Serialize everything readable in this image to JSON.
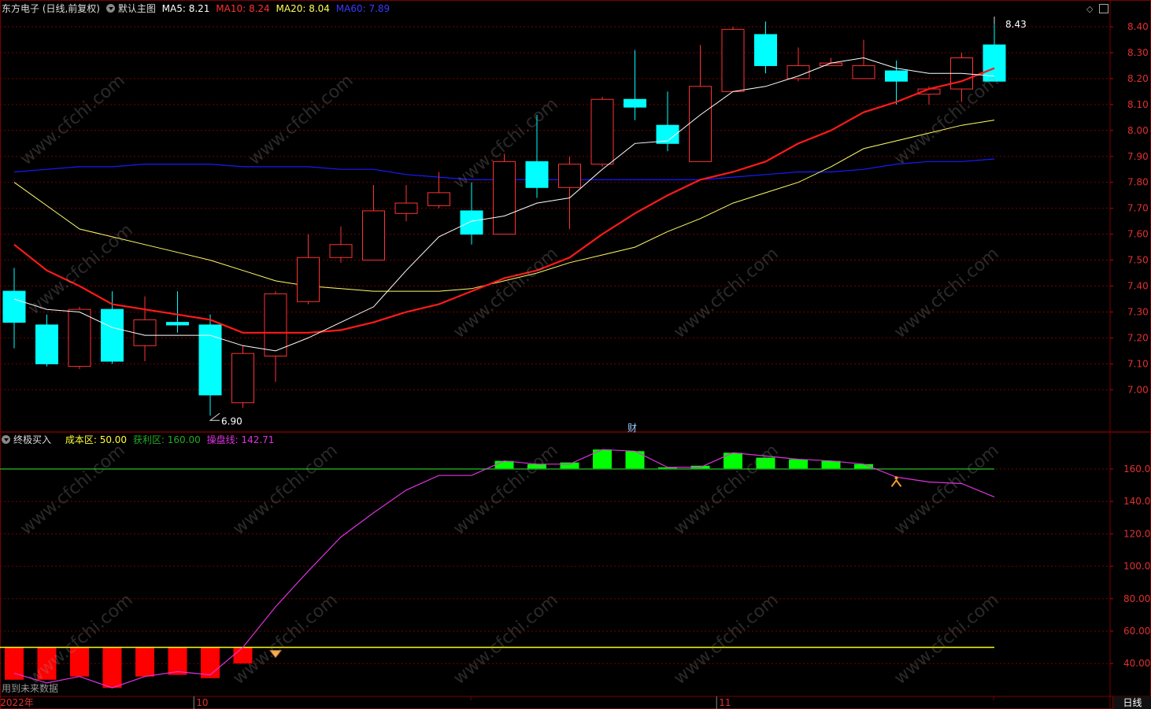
{
  "header_main": {
    "stock_title": "东方电子 (日线,前复权)",
    "template_name": "默认主图",
    "ma5": "MA5: 8.21",
    "ma10": "MA10: 8.24",
    "ma20": "MA20: 8.04",
    "ma60": "MA60: 7.89"
  },
  "header_sub": {
    "indicator_name": "终极买入",
    "cost_zone": "成本区: 50.00",
    "profit_zone": "获利区: 160.00",
    "control_line": "操盘线: 142.71"
  },
  "annotations": {
    "low_label": "6.90",
    "high_label": "8.43",
    "finance_marker": "财"
  },
  "bottom": {
    "status_text": "用到未来数据",
    "period_button": "日线"
  },
  "watermark_text": "www.cfchi.com",
  "colors": {
    "up": "#ff3232",
    "down": "#00ffff",
    "ma5": "#ffffff",
    "ma10": "#ff1a1a",
    "ma20": "#ffff66",
    "ma60": "#1a1aff",
    "grid": "#7a0000",
    "cost_line": "#ffff00",
    "profit_line": "#1fa01f",
    "control_line": "#dd33dd",
    "bar_green": "#00ff00",
    "bar_red": "#ff0000"
  },
  "chart_data": [
    {
      "type": "candlestick",
      "y_axis_labels": [
        "8.40",
        "8.30",
        "8.20",
        "8.10",
        "8.00",
        "7.90",
        "7.80",
        "7.70",
        "7.60",
        "7.50",
        "7.40",
        "7.30",
        "7.20",
        "7.10",
        "7.00"
      ],
      "ylim": [
        6.85,
        8.45
      ],
      "x_labels": [
        {
          "index": 0,
          "text": "2022年"
        },
        {
          "index": 6,
          "text": "10"
        },
        {
          "index": 22,
          "text": "11"
        }
      ],
      "candles": [
        {
          "o": 7.38,
          "h": 7.47,
          "l": 7.16,
          "c": 7.26
        },
        {
          "o": 7.25,
          "h": 7.29,
          "l": 7.09,
          "c": 7.1
        },
        {
          "o": 7.09,
          "h": 7.32,
          "l": 7.08,
          "c": 7.31
        },
        {
          "o": 7.31,
          "h": 7.38,
          "l": 7.1,
          "c": 7.11
        },
        {
          "o": 7.17,
          "h": 7.36,
          "l": 7.11,
          "c": 7.27
        },
        {
          "o": 7.26,
          "h": 7.38,
          "l": 7.22,
          "c": 7.25
        },
        {
          "o": 7.25,
          "h": 7.29,
          "l": 6.9,
          "c": 6.98
        },
        {
          "o": 6.95,
          "h": 7.17,
          "l": 6.93,
          "c": 7.14
        },
        {
          "o": 7.13,
          "h": 7.38,
          "l": 7.03,
          "c": 7.37
        },
        {
          "o": 7.34,
          "h": 7.6,
          "l": 7.33,
          "c": 7.51
        },
        {
          "o": 7.51,
          "h": 7.63,
          "l": 7.49,
          "c": 7.56
        },
        {
          "o": 7.5,
          "h": 7.79,
          "l": 7.5,
          "c": 7.69
        },
        {
          "o": 7.68,
          "h": 7.79,
          "l": 7.65,
          "c": 7.72
        },
        {
          "o": 7.71,
          "h": 7.84,
          "l": 7.7,
          "c": 7.76
        },
        {
          "o": 7.69,
          "h": 7.8,
          "l": 7.56,
          "c": 7.6
        },
        {
          "o": 7.6,
          "h": 7.91,
          "l": 7.6,
          "c": 7.88
        },
        {
          "o": 7.88,
          "h": 8.06,
          "l": 7.74,
          "c": 7.78
        },
        {
          "o": 7.78,
          "h": 7.9,
          "l": 7.62,
          "c": 7.87
        },
        {
          "o": 7.87,
          "h": 8.13,
          "l": 7.86,
          "c": 8.12
        },
        {
          "o": 8.12,
          "h": 8.31,
          "l": 8.04,
          "c": 8.09
        },
        {
          "o": 8.02,
          "h": 8.15,
          "l": 7.92,
          "c": 7.95
        },
        {
          "o": 7.88,
          "h": 8.33,
          "l": 7.88,
          "c": 8.17
        },
        {
          "o": 8.15,
          "h": 8.4,
          "l": 8.15,
          "c": 8.39
        },
        {
          "o": 8.37,
          "h": 8.42,
          "l": 8.22,
          "c": 8.25
        },
        {
          "o": 8.2,
          "h": 8.32,
          "l": 8.19,
          "c": 8.25
        },
        {
          "o": 8.25,
          "h": 8.28,
          "l": 8.25,
          "c": 8.26
        },
        {
          "o": 8.2,
          "h": 8.35,
          "l": 8.2,
          "c": 8.25
        },
        {
          "o": 8.23,
          "h": 8.27,
          "l": 8.1,
          "c": 8.19
        },
        {
          "o": 8.14,
          "h": 8.17,
          "l": 8.1,
          "c": 8.16
        },
        {
          "o": 8.16,
          "h": 8.3,
          "l": 8.11,
          "c": 8.28
        },
        {
          "o": 8.33,
          "h": 8.43,
          "l": 8.2,
          "c": 8.19
        }
      ],
      "ma5": [
        7.35,
        7.31,
        7.3,
        7.24,
        7.21,
        7.21,
        7.21,
        7.17,
        7.15,
        7.2,
        7.26,
        7.32,
        7.46,
        7.59,
        7.65,
        7.67,
        7.72,
        7.74,
        7.85,
        7.95,
        7.96,
        8.06,
        8.15,
        8.17,
        8.21,
        8.26,
        8.28,
        8.24,
        8.22,
        8.22,
        8.21
      ],
      "ma10": [
        7.56,
        7.46,
        7.4,
        7.33,
        7.31,
        7.29,
        7.27,
        7.22,
        7.22,
        7.22,
        7.23,
        7.26,
        7.3,
        7.33,
        7.38,
        7.43,
        7.46,
        7.51,
        7.6,
        7.68,
        7.75,
        7.81,
        7.84,
        7.88,
        7.95,
        8.0,
        8.07,
        8.11,
        8.16,
        8.19,
        8.24
      ],
      "ma20": [
        7.8,
        7.71,
        7.62,
        7.59,
        7.56,
        7.53,
        7.5,
        7.46,
        7.42,
        7.4,
        7.39,
        7.38,
        7.38,
        7.38,
        7.39,
        7.42,
        7.45,
        7.49,
        7.52,
        7.55,
        7.61,
        7.66,
        7.72,
        7.76,
        7.8,
        7.86,
        7.93,
        7.96,
        7.99,
        8.02,
        8.04
      ],
      "ma60": [
        7.84,
        7.85,
        7.86,
        7.86,
        7.87,
        7.87,
        7.87,
        7.86,
        7.86,
        7.86,
        7.85,
        7.85,
        7.83,
        7.82,
        7.81,
        7.81,
        7.81,
        7.81,
        7.81,
        7.81,
        7.81,
        7.81,
        7.82,
        7.83,
        7.84,
        7.84,
        7.85,
        7.87,
        7.88,
        7.88,
        7.89
      ]
    },
    {
      "type": "indicator",
      "y_axis_labels": [
        "160.0",
        "140.00",
        "120.00",
        "100.00",
        "80.00",
        "60.00",
        "40.00"
      ],
      "ylim": [
        24,
        180
      ],
      "cost_zone": 50,
      "profit_zone": 160,
      "control_line": [
        34,
        28,
        32,
        25,
        32,
        35,
        33,
        50,
        75,
        97,
        118,
        133,
        147,
        156,
        156,
        165,
        163,
        163,
        172,
        171,
        161,
        161,
        170,
        168,
        166,
        165,
        163,
        155,
        152,
        151,
        142.71
      ],
      "bar_top": [
        30,
        30,
        32,
        25,
        32,
        33,
        31,
        40,
        0,
        0,
        0,
        0,
        0,
        0,
        0,
        165,
        163,
        164,
        172,
        171,
        161,
        162,
        170,
        167,
        166,
        165,
        163,
        0,
        0,
        0,
        0
      ],
      "bar_color": [
        "red",
        "red",
        "red",
        "red",
        "red",
        "red",
        "red",
        "red",
        "none",
        "none",
        "none",
        "none",
        "none",
        "none",
        "none",
        "green",
        "green",
        "green",
        "green",
        "green",
        "green",
        "green",
        "green",
        "green",
        "green",
        "green",
        "green",
        "none",
        "none",
        "none",
        "none"
      ],
      "buy_marker_index": 8,
      "sell_marker_index": 27
    }
  ]
}
